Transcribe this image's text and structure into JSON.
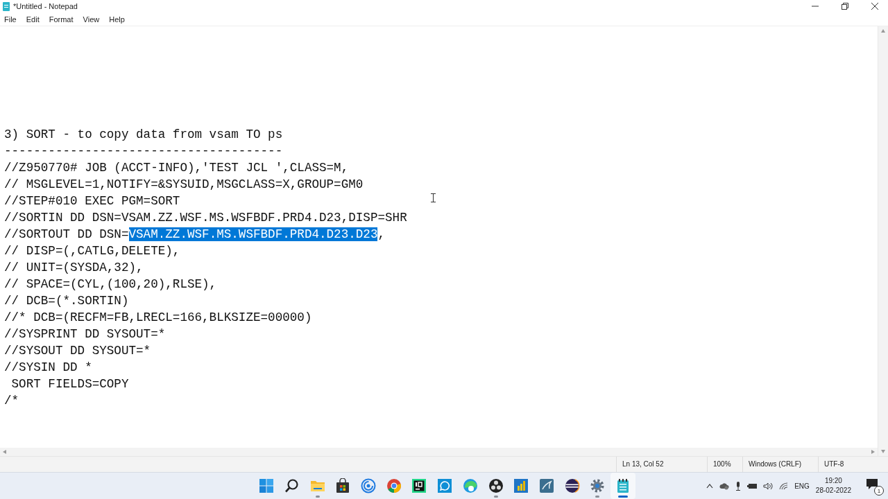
{
  "window": {
    "title": "*Untitled - Notepad"
  },
  "menu": [
    {
      "label": "File"
    },
    {
      "label": "Edit"
    },
    {
      "label": "Format"
    },
    {
      "label": "View"
    },
    {
      "label": "Help"
    }
  ],
  "editor": {
    "lines": [
      {
        "segments": [
          {
            "text": "3) SORT - to copy data from vsam TO ps",
            "selected": false
          }
        ]
      },
      {
        "segments": [
          {
            "text": "--------------------------------------",
            "selected": false
          }
        ]
      },
      {
        "segments": [
          {
            "text": "//Z950770# JOB (ACCT-INFO),'TEST JCL ',CLASS=M,",
            "selected": false
          }
        ]
      },
      {
        "segments": [
          {
            "text": "// MSGLEVEL=1,NOTIFY=&SYSUID,MSGCLASS=X,GROUP=GM0",
            "selected": false
          }
        ]
      },
      {
        "segments": [
          {
            "text": "//STEP#010 EXEC PGM=SORT",
            "selected": false
          }
        ]
      },
      {
        "segments": [
          {
            "text": "//SORTIN DD DSN=VSAM.ZZ.WSF.MS.WSFBDF.PRD4.D23,DISP=SHR",
            "selected": false
          }
        ]
      },
      {
        "segments": [
          {
            "text": "//SORTOUT DD DSN=",
            "selected": false
          },
          {
            "text": "VSAM.ZZ.WSF.MS.WSFBDF.PRD4.D23.D23",
            "selected": true
          },
          {
            "text": ",",
            "selected": false
          }
        ]
      },
      {
        "segments": [
          {
            "text": "// DISP=(,CATLG,DELETE),",
            "selected": false
          }
        ]
      },
      {
        "segments": [
          {
            "text": "// UNIT=(SYSDA,32),",
            "selected": false
          }
        ]
      },
      {
        "segments": [
          {
            "text": "// SPACE=(CYL,(100,20),RLSE),",
            "selected": false
          }
        ]
      },
      {
        "segments": [
          {
            "text": "// DCB=(*.SORTIN)",
            "selected": false
          }
        ]
      },
      {
        "segments": [
          {
            "text": "//* DCB=(RECFM=FB,LRECL=166,BLKSIZE=00000)",
            "selected": false
          }
        ]
      },
      {
        "segments": [
          {
            "text": "//SYSPRINT DD SYSOUT=*",
            "selected": false
          }
        ]
      },
      {
        "segments": [
          {
            "text": "//SYSOUT DD SYSOUT=*",
            "selected": false
          }
        ]
      },
      {
        "segments": [
          {
            "text": "//SYSIN DD *",
            "selected": false
          }
        ]
      },
      {
        "segments": [
          {
            "text": " SORT FIELDS=COPY",
            "selected": false
          }
        ]
      },
      {
        "segments": [
          {
            "text": "/*",
            "selected": false
          }
        ]
      }
    ]
  },
  "status_bar": [
    {
      "text": "Ln 13, Col 52"
    },
    {
      "text": "100%"
    },
    {
      "text": "Windows (CRLF)"
    },
    {
      "text": "UTF-8"
    }
  ],
  "taskbar": {
    "apps": [
      {
        "kind": "start",
        "running": false,
        "active": false
      },
      {
        "kind": "search",
        "running": false,
        "active": false
      },
      {
        "kind": "folder",
        "running": true,
        "active": false
      },
      {
        "kind": "store",
        "running": false,
        "active": false
      },
      {
        "kind": "spiral",
        "running": false,
        "active": false
      },
      {
        "kind": "chrome",
        "running": false,
        "active": false
      },
      {
        "kind": "ide",
        "running": false,
        "active": false
      },
      {
        "kind": "chat",
        "running": false,
        "active": false
      },
      {
        "kind": "edge",
        "running": false,
        "active": false
      },
      {
        "kind": "obs",
        "running": true,
        "active": false
      },
      {
        "kind": "chart",
        "running": false,
        "active": false
      },
      {
        "kind": "database",
        "running": false,
        "active": false
      },
      {
        "kind": "eclipse",
        "running": false,
        "active": false
      },
      {
        "kind": "settings",
        "running": true,
        "active": false
      },
      {
        "kind": "notepad",
        "running": true,
        "active": true
      }
    ],
    "tray": {
      "language": "ENG",
      "time": "19:20",
      "date": "28-02-2022",
      "notification_count": "1"
    }
  }
}
